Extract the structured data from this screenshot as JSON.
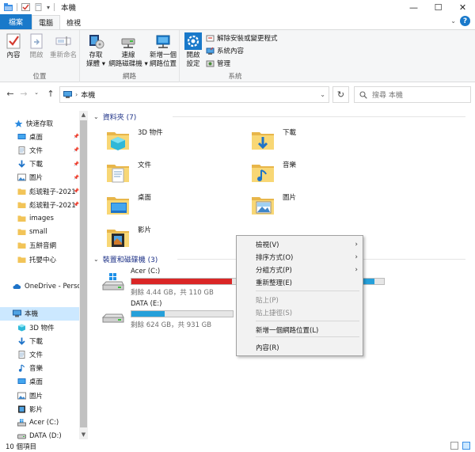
{
  "window": {
    "title": "本機",
    "controls": [
      "—",
      "☐",
      "✕"
    ]
  },
  "ribbon_tabs": [
    {
      "label": "檔案"
    },
    {
      "label": "電腦"
    },
    {
      "label": "檢視"
    }
  ],
  "ribbon": {
    "location": {
      "title": "位置",
      "buttons": [
        {
          "label": "內容",
          "icon": "checkmark-properties-icon"
        },
        {
          "label": "開啟",
          "icon": "open-file-icon"
        },
        {
          "label": "重新命名",
          "icon": "rename-icon"
        }
      ]
    },
    "network": {
      "title": "網路",
      "buttons": [
        {
          "label": "存取\n媒體 ▾",
          "icon": "media-icon"
        },
        {
          "label": "連線\n網路磁碟機 ▾",
          "icon": "network-drive-icon"
        },
        {
          "label": "新增一個\n網路位置",
          "icon": "network-location-icon"
        }
      ]
    },
    "system": {
      "title": "系統",
      "open_settings": "開啟\n設定",
      "small_buttons": [
        {
          "label": "解除安裝或變更程式",
          "icon": "uninstall-icon"
        },
        {
          "label": "系統內容",
          "icon": "system-properties-icon"
        },
        {
          "label": "管理",
          "icon": "manage-icon"
        }
      ]
    }
  },
  "address": {
    "path": "本機",
    "search_placeholder": "搜尋 本機"
  },
  "nav_pane": [
    {
      "label": "快速存取",
      "icon": "star-icon",
      "pinned": false,
      "indent": 18
    },
    {
      "label": "桌面",
      "icon": "desktop-icon",
      "pinned": true,
      "indent": 22
    },
    {
      "label": "文件",
      "icon": "documents-icon",
      "pinned": true,
      "indent": 22
    },
    {
      "label": "下載",
      "icon": "downloads-icon",
      "pinned": true,
      "indent": 22
    },
    {
      "label": "圖片",
      "icon": "pictures-icon",
      "pinned": true,
      "indent": 22
    },
    {
      "label": "彪琥鞋子-2021",
      "icon": "folder-icon",
      "pinned": true,
      "indent": 22
    },
    {
      "label": "彪琥鞋子-2021",
      "icon": "folder-icon",
      "pinned": true,
      "indent": 22
    },
    {
      "label": "images",
      "icon": "folder-icon",
      "pinned": false,
      "indent": 22
    },
    {
      "label": "small",
      "icon": "folder-icon",
      "pinned": false,
      "indent": 22
    },
    {
      "label": "五餅音網",
      "icon": "folder-icon",
      "pinned": false,
      "indent": 22
    },
    {
      "label": "托嬰中心",
      "icon": "folder-icon",
      "pinned": false,
      "indent": 22
    },
    {
      "label": "",
      "icon": "",
      "pinned": false,
      "indent": 0
    },
    {
      "label": "OneDrive - Personal",
      "icon": "cloud-icon",
      "pinned": false,
      "indent": 16
    },
    {
      "label": "",
      "icon": "",
      "pinned": false,
      "indent": 0
    },
    {
      "label": "本機",
      "icon": "computer-icon",
      "pinned": false,
      "indent": 16,
      "selected": true
    },
    {
      "label": "3D 物件",
      "icon": "3d-objects-icon",
      "pinned": false,
      "indent": 22
    },
    {
      "label": "下載",
      "icon": "downloads-icon",
      "pinned": false,
      "indent": 22
    },
    {
      "label": "文件",
      "icon": "documents-icon",
      "pinned": false,
      "indent": 22
    },
    {
      "label": "音樂",
      "icon": "music-icon",
      "pinned": false,
      "indent": 22
    },
    {
      "label": "桌面",
      "icon": "desktop-icon",
      "pinned": false,
      "indent": 22
    },
    {
      "label": "圖片",
      "icon": "pictures-icon",
      "pinned": false,
      "indent": 22
    },
    {
      "label": "影片",
      "icon": "videos-icon",
      "pinned": false,
      "indent": 22
    },
    {
      "label": "Acer (C:)",
      "icon": "windows-drive-icon",
      "pinned": false,
      "indent": 22
    },
    {
      "label": "DATA (D:)",
      "icon": "drive-icon",
      "pinned": false,
      "indent": 22
    },
    {
      "label": "DATA (E:)",
      "icon": "drive-icon",
      "pinned": false,
      "indent": 22
    }
  ],
  "folders_group": {
    "title": "資料夾 (7)"
  },
  "folders": [
    {
      "label": "3D 物件",
      "icon": "3d-objects-folder-icon"
    },
    {
      "label": "下載",
      "icon": "downloads-folder-icon"
    },
    {
      "label": "文件",
      "icon": "documents-folder-icon"
    },
    {
      "label": "音樂",
      "icon": "music-folder-icon"
    },
    {
      "label": "桌面",
      "icon": "desktop-folder-icon"
    },
    {
      "label": "圖片",
      "icon": "pictures-folder-icon"
    },
    {
      "label": "影片",
      "icon": "videos-folder-icon"
    }
  ],
  "drives_group": {
    "title": "裝置和磁碟機 (3)"
  },
  "drives": [
    {
      "name": "Acer (C:)",
      "info": "剩餘 4.44 GB，共 110 GB",
      "used_fraction": 0.96,
      "color": "#da2626",
      "icon": "windows-drive-icon"
    },
    {
      "name": "DATA (D:)",
      "info": "",
      "used_fraction": 0.55,
      "color": "#26a0da",
      "icon": "drive-icon"
    },
    {
      "name": "DATA (E:)",
      "info": "剩餘 624 GB，共 931 GB",
      "used_fraction": 0.33,
      "color": "#26a0da",
      "icon": "drive-icon"
    }
  ],
  "context_menu": [
    {
      "label": "檢視(V)",
      "submenu": true,
      "disabled": false
    },
    {
      "label": "排序方式(O)",
      "submenu": true,
      "disabled": false
    },
    {
      "label": "分組方式(P)",
      "submenu": true,
      "disabled": false
    },
    {
      "label": "重新整理(E)",
      "submenu": false,
      "disabled": false
    },
    {
      "label": "貼上(P)",
      "submenu": false,
      "disabled": true
    },
    {
      "label": "貼上捷徑(S)",
      "submenu": false,
      "disabled": true
    },
    {
      "label": "新增一個網路位置(L)",
      "submenu": false,
      "disabled": false
    },
    {
      "label": "內容(R)",
      "submenu": false,
      "disabled": false
    }
  ],
  "status": {
    "count": "10 個項目"
  },
  "colors": {
    "accent": "#1979ca",
    "selection": "#cce8ff",
    "link": "#1e3287"
  }
}
